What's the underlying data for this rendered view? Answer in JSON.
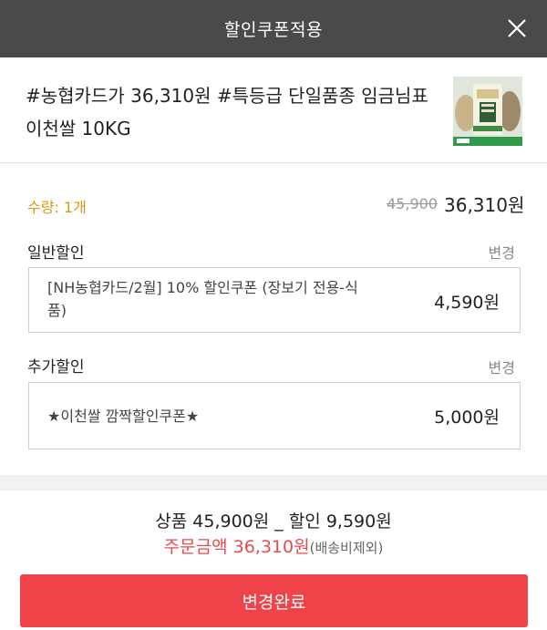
{
  "header": {
    "title": "할인쿠폰적용",
    "close_icon": "close-icon"
  },
  "product": {
    "name": "#농협카드가 36,310원 #특등급 단일품종 임금님표 이천쌀 10KG",
    "thumbnail_icon": "rice-bag-image"
  },
  "price": {
    "quantity": "수량: 1개",
    "original": "45,900",
    "sale": "36,310원"
  },
  "general_discount": {
    "label": "일반할인",
    "change": "변경",
    "coupon_line1": "[NH농협카드/2월] 10% 할인쿠폰 (장보기 전용-식",
    "coupon_line2": "품)",
    "amount": "4,590원"
  },
  "extra_discount": {
    "label": "추가할인",
    "change": "변경",
    "coupon": "★이천쌀 깜짝할인쿠폰★",
    "amount": "5,000원"
  },
  "summary": {
    "line1": "상품 45,900원 _ 할인 9,590원",
    "order_label": "주문금액 36,310원",
    "shipping_note": "(배송비제외)"
  },
  "confirm_button": "변경완료",
  "colors": {
    "header_bg": "#4a4a4a",
    "accent_red": "#ef4349",
    "quantity_gold": "#d49a15"
  }
}
